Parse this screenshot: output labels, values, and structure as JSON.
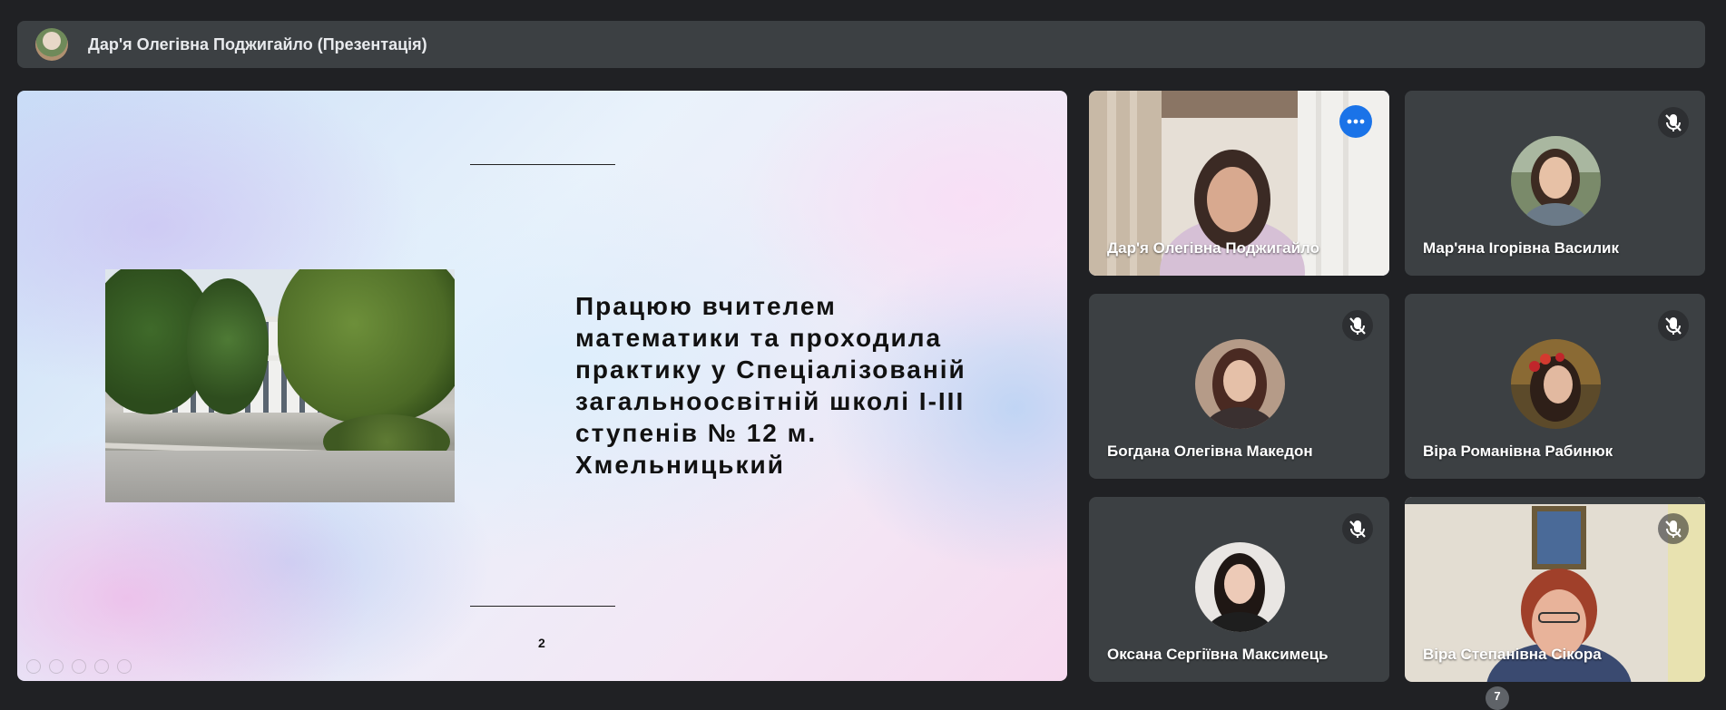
{
  "header": {
    "presenter_label": "Дар'я Олегівна Поджигайло (Презентація)"
  },
  "slide": {
    "body_lines": [
      "Працюю вчителем",
      "математики та проходила",
      "практику у Спеціалізованій",
      "загальноосвітній школі І-ІІІ",
      "ступенів № 12 м.",
      "Хмельницький"
    ],
    "page_number": "2"
  },
  "participants": [
    {
      "name": "Дар'я Олегівна Поджигайло",
      "state": "speaking-video",
      "icon": "more-options-icon"
    },
    {
      "name": "Мар'яна Ігорівна Василик",
      "state": "avatar",
      "icon": "mic-off-icon"
    },
    {
      "name": "Богдана Олегівна Македон",
      "state": "avatar",
      "icon": "mic-off-icon"
    },
    {
      "name": "Віра Романівна Рабинюк",
      "state": "avatar",
      "icon": "mic-off-icon"
    },
    {
      "name": "Оксана Сергіївна Максимець",
      "state": "avatar",
      "icon": "mic-off-icon"
    },
    {
      "name": "Віра Степанівна Сікора",
      "state": "video",
      "icon": "mic-off-icon"
    }
  ],
  "footer": {
    "people_count": "7"
  },
  "colors": {
    "background": "#202124",
    "tile": "#3c4043",
    "active_outline": "#8ab4f8",
    "more_button": "#1a73e8"
  }
}
